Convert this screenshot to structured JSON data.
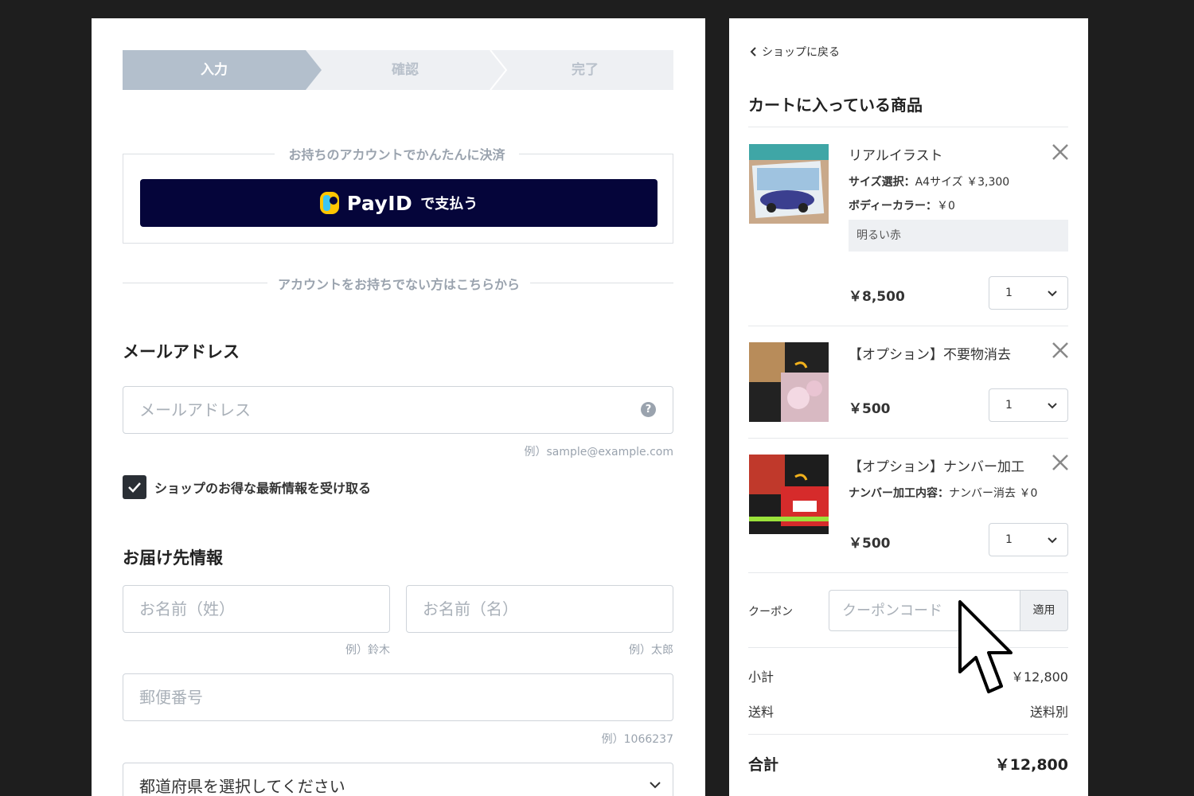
{
  "stepper": {
    "steps": [
      "入力",
      "確認",
      "完了"
    ],
    "active_index": 0
  },
  "payid_section": {
    "legend": "お持ちのアカウントでかんたんに決済",
    "button_brand": "PayID",
    "button_suffix": "で支払う"
  },
  "no_account_divider": "アカウントをお持ちでない方はこちらから",
  "email_section": {
    "title": "メールアドレス",
    "placeholder": "メールアドレス",
    "hint": "例）sample@example.com",
    "help_icon": "?"
  },
  "newsletter": {
    "checked": true,
    "label": "ショップのお得な最新情報を受け取る"
  },
  "shipping_section": {
    "title": "お届け先情報",
    "last_name_placeholder": "お名前（姓）",
    "last_name_hint": "例）鈴木",
    "first_name_placeholder": "お名前（名）",
    "first_name_hint": "例）太郎",
    "postal_placeholder": "郵便番号",
    "postal_hint": "例）1066237",
    "prefecture_select": "都道府県を選択してください"
  },
  "cart": {
    "back_label": "ショップに戻る",
    "title": "カートに入っている商品",
    "items": [
      {
        "name": "リアルイラスト",
        "options": [
          {
            "label": "サイズ選択：",
            "value": "A4サイズ ￥3,300"
          },
          {
            "label": "ボディーカラー：",
            "value": "￥0"
          }
        ],
        "note": "明るい赤",
        "price": "￥8,500",
        "qty": "1"
      },
      {
        "name": "【オプション】不要物消去",
        "options": [],
        "price": "￥500",
        "qty": "1"
      },
      {
        "name": "【オプション】ナンバー加工",
        "options": [
          {
            "label": "ナンバー加工内容：",
            "value": "ナンバー消去 ￥0"
          }
        ],
        "price": "￥500",
        "qty": "1"
      }
    ],
    "coupon": {
      "label": "クーポン",
      "placeholder": "クーポンコード",
      "button": "適用"
    },
    "subtotal": {
      "label": "小計",
      "value": "￥12,800"
    },
    "shipping": {
      "label": "送料",
      "value": "送料別"
    },
    "total": {
      "label": "合計",
      "value": "￥12,800"
    }
  },
  "colors": {
    "payid_button_bg": "#05053a",
    "stepper_active": "#b3bfcc",
    "stepper_inactive": "#eef0f3",
    "checkbox": "#2a2f35"
  },
  "icons": [
    "chevron-left-icon",
    "close-icon",
    "chevron-down-icon",
    "help-icon",
    "checkmark-icon",
    "payid-logo-icon",
    "mouse-cursor-icon"
  ]
}
